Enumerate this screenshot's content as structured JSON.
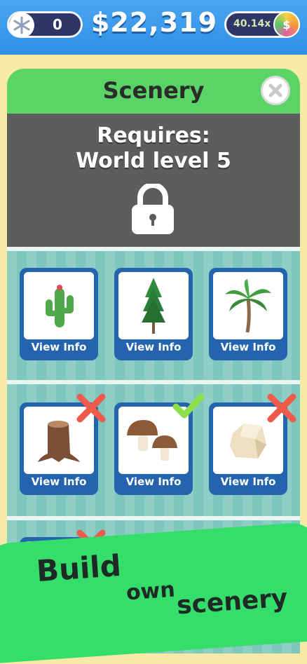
{
  "top_bar": {
    "gems": "0",
    "money": "$22,319",
    "multiplier": "40.14x",
    "orb_symbol": "$"
  },
  "panel": {
    "title": "Scenery",
    "locked": {
      "line1": "Requires:",
      "line2": "World level 5"
    }
  },
  "items": [
    {
      "name": "cactus",
      "label": "View Info",
      "status": "none"
    },
    {
      "name": "pine-tree",
      "label": "View Info",
      "status": "none"
    },
    {
      "name": "palm-tree",
      "label": "View Info",
      "status": "none"
    },
    {
      "name": "tree-stump",
      "label": "View Info",
      "status": "unavailable"
    },
    {
      "name": "mushrooms",
      "label": "View Info",
      "status": "selected"
    },
    {
      "name": "rock",
      "label": "View Info",
      "status": "unavailable"
    }
  ],
  "banner": {
    "line1": "Build",
    "line2": "own",
    "line3": "scenery"
  },
  "colors": {
    "top_bar": "#2f8fe6",
    "panel": "#5ad466",
    "locked_header": "#5d5d5d",
    "card": "#2463ad",
    "grid_bg": "#7fc7bd",
    "x_mark": "#ef5a4a",
    "check_mark": "#8ee04b",
    "banner": "#35dd6a"
  }
}
